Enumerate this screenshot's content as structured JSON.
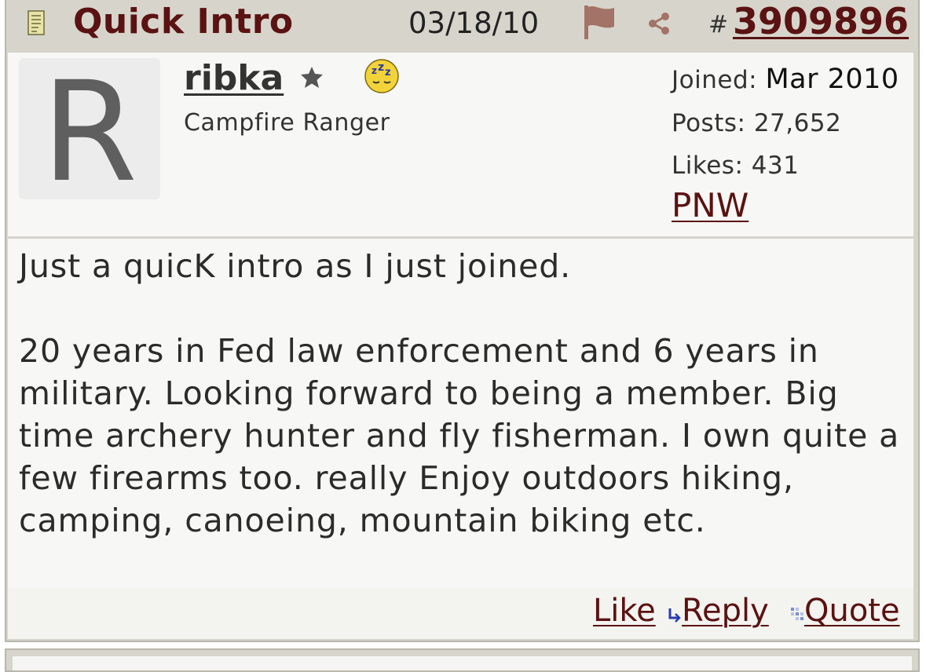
{
  "header": {
    "title": "Quick Intro",
    "date": "03/18/10",
    "hash": "#",
    "post_number": "3909896"
  },
  "user": {
    "avatar_letter": "R",
    "username": "ribka",
    "title": "Campfire Ranger",
    "joined_label": "Joined:",
    "joined_value": "Mar 2010",
    "posts_label": "Posts:",
    "posts_value": "27,652",
    "likes_label": "Likes:",
    "likes_value": "431",
    "location": "PNW"
  },
  "post": {
    "paragraphs": [
      "Just a quicK intro as I just joined.",
      "20 years in Fed law enforcement and 6 years in military. Looking forward to being a member. Big time archery hunter and fly fisherman. I own quite a few firearms too. really Enjoy outdoors hiking, camping, canoeing, mountain biking etc."
    ]
  },
  "actions": {
    "like": "Like",
    "reply": "Reply",
    "quote": "Quote"
  },
  "colors": {
    "accent": "#5a1212",
    "frame": "#d7d5cb",
    "panel": "#f7f7f5",
    "text": "#2b2b2b"
  },
  "icons": [
    "doc-icon",
    "flag-icon",
    "share-icon",
    "star-icon",
    "mood-sleepy-icon",
    "reply-icon",
    "quote-icon"
  ]
}
